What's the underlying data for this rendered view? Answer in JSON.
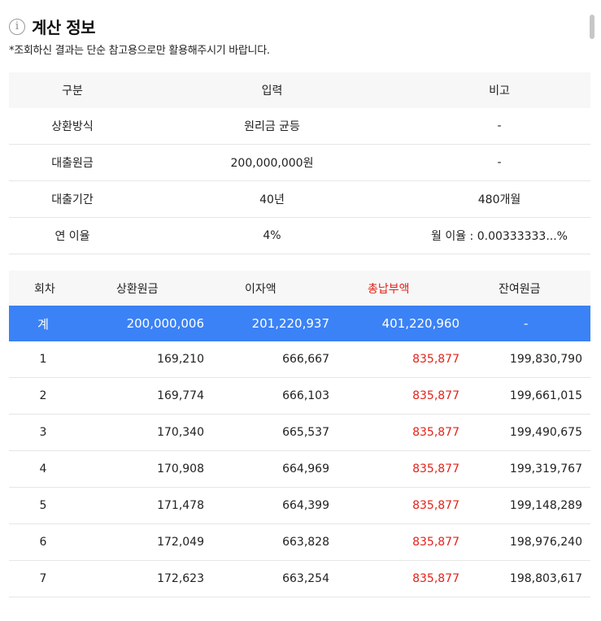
{
  "header": {
    "icon": "info-icon",
    "title": "계산 정보",
    "note": "*조회하신 결과는 단순 참고용으로만 활용해주시기 바랍니다."
  },
  "summary": {
    "columns": [
      "구분",
      "입력",
      "비고"
    ],
    "rows": [
      {
        "label": "상환방식",
        "input": "원리금 균등",
        "note": "-"
      },
      {
        "label": "대출원금",
        "input": "200,000,000원",
        "note": "-"
      },
      {
        "label": "대출기간",
        "input": "40년",
        "note": "480개월"
      },
      {
        "label": "연 이율",
        "input": "4%",
        "note": "월 이율 : 0.00333333...%"
      }
    ]
  },
  "schedule": {
    "columns": [
      "회차",
      "상환원금",
      "이자액",
      "총납부액",
      "잔여원금"
    ],
    "total": {
      "label": "계",
      "principal": "200,000,006",
      "interest": "201,220,937",
      "payment": "401,220,960",
      "balance": "-"
    },
    "rows": [
      {
        "no": "1",
        "principal": "169,210",
        "interest": "666,667",
        "payment": "835,877",
        "balance": "199,830,790"
      },
      {
        "no": "2",
        "principal": "169,774",
        "interest": "666,103",
        "payment": "835,877",
        "balance": "199,661,015"
      },
      {
        "no": "3",
        "principal": "170,340",
        "interest": "665,537",
        "payment": "835,877",
        "balance": "199,490,675"
      },
      {
        "no": "4",
        "principal": "170,908",
        "interest": "664,969",
        "payment": "835,877",
        "balance": "199,319,767"
      },
      {
        "no": "5",
        "principal": "171,478",
        "interest": "664,399",
        "payment": "835,877",
        "balance": "199,148,289"
      },
      {
        "no": "6",
        "principal": "172,049",
        "interest": "663,828",
        "payment": "835,877",
        "balance": "198,976,240"
      },
      {
        "no": "7",
        "principal": "172,623",
        "interest": "663,254",
        "payment": "835,877",
        "balance": "198,803,617"
      }
    ]
  },
  "colors": {
    "accent": "#3b82f6",
    "highlight": "#e2231a",
    "header_bg": "#f7f7f7"
  }
}
